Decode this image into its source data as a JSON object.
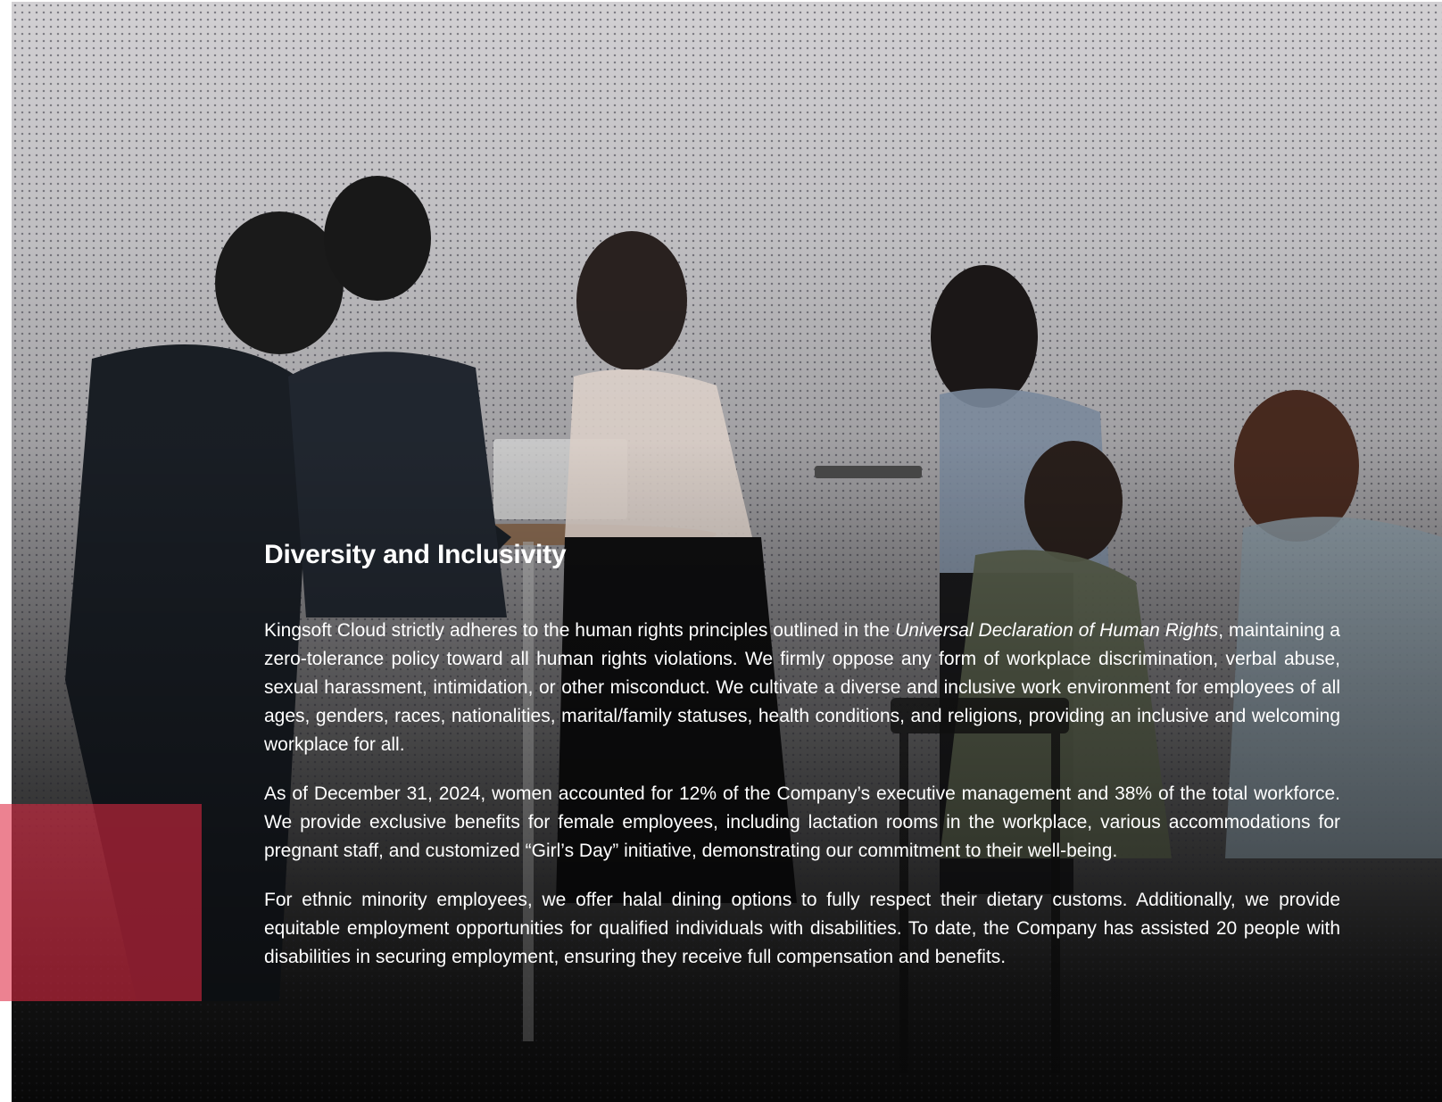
{
  "section": {
    "title": "Diversity and Inclusivity",
    "paragraphs": {
      "p1": {
        "before": "Kingsoft Cloud strictly adheres to the human rights principles outlined in the ",
        "emphasis": "Universal Declaration of Human Rights",
        "after": ", maintaining a zero-tolerance policy toward all human rights violations. We firmly oppose any form of workplace discrimination, verbal abuse, sexual harassment, intimidation, or other misconduct. We cultivate a diverse and inclusive work environment for employees of all ages, genders, races, nationalities, marital/family statuses, health conditions, and religions, providing an inclusive and welcoming workplace for all."
      },
      "p2": "As of December 31, 2024, women accounted for 12% of the Company’s executive management and 38% of the total workforce. We provide exclusive benefits for female employees, including lactation rooms in the workplace, various accommodations for pregnant staff, and customized “Girl’s Day” initiative, demonstrating our commitment to their well-being.",
      "p3": "For ethnic minority employees, we offer halal dining options to fully respect their dietary customs. Additionally, we provide equitable employment opportunities for qualified individuals with disabilities. To date, the Company has assisted 20 people with disabilities in securing employment, ensuring they receive full compensation and benefits."
    }
  },
  "colors": {
    "accent": "#de2842",
    "text": "#ffffff"
  }
}
